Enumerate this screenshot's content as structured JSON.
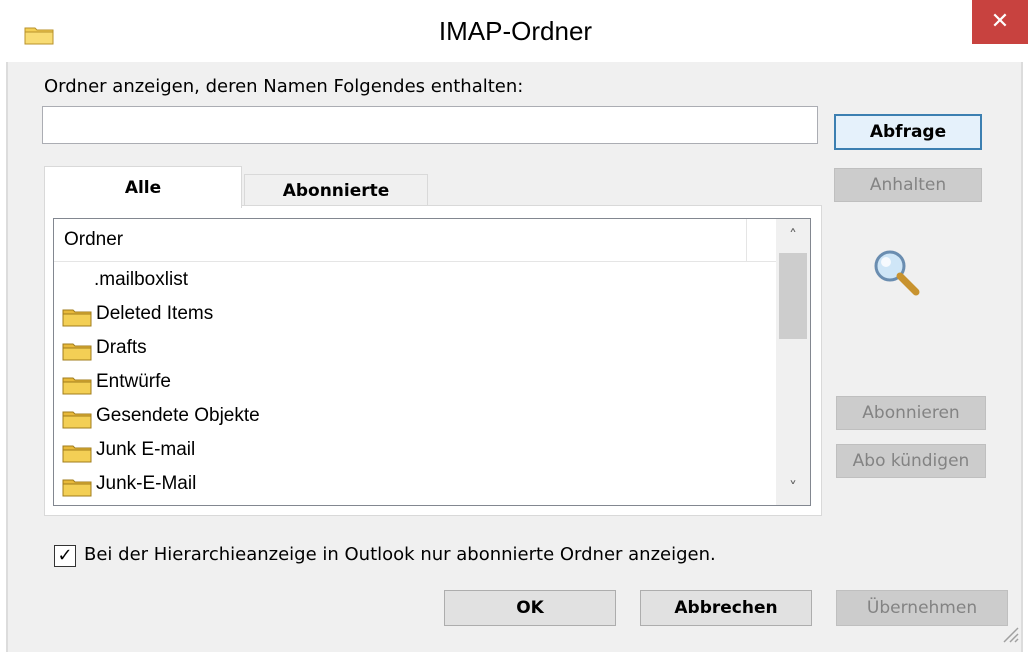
{
  "window": {
    "title": "IMAP-Ordner",
    "close_label": "✕"
  },
  "filter": {
    "label": "Ordner anzeigen, deren Namen Folgendes enthalten:",
    "value": "",
    "placeholder": ""
  },
  "buttons": {
    "query": "Abfrage",
    "stop": "Anhalten",
    "subscribe": "Abonnieren",
    "unsubscribe": "Abo kündigen",
    "ok": "OK",
    "cancel": "Abbrechen",
    "apply": "Übernehmen"
  },
  "tabs": [
    {
      "label": "Alle",
      "active": true
    },
    {
      "label": "Abonnierte",
      "active": false
    }
  ],
  "list": {
    "column_header": "Ordner",
    "items": [
      {
        "label": ".mailboxlist",
        "icon": "none"
      },
      {
        "label": "Deleted Items",
        "icon": "folder-icon"
      },
      {
        "label": "Drafts",
        "icon": "folder-icon"
      },
      {
        "label": "Entwürfe",
        "icon": "folder-icon"
      },
      {
        "label": "Gesendete Objekte",
        "icon": "folder-icon"
      },
      {
        "label": "Junk E-mail",
        "icon": "folder-icon"
      },
      {
        "label": "Junk-E-Mail",
        "icon": "folder-icon"
      }
    ]
  },
  "checkbox": {
    "checked": true,
    "mark": "✓",
    "label": "Bei der Hierarchieanzeige in Outlook nur abonnierte Ordner anzeigen."
  },
  "scrollbar": {
    "up_glyph": "˄",
    "down_glyph": "˅"
  },
  "colors": {
    "close_button": "#c8423f",
    "default_button_border": "#3c7fb1",
    "folder_yellow": "#f3cf55"
  }
}
